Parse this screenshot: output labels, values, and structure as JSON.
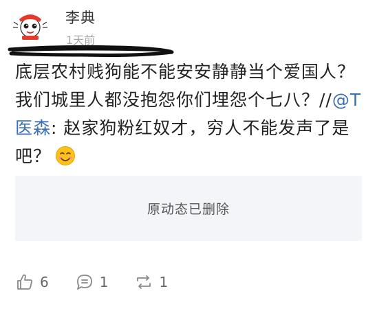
{
  "post": {
    "author": "李典",
    "time": "1天前",
    "text_main": "底层农村贱狗能不能安安静静当个爱国人？我们城里人都没抱怨你们埋怨个七八？//",
    "mention": "@T医森",
    "text_tail": ": 赵家狗粉红奴才，穷人不能发声了是吧？",
    "emoji": "smiling-face-emoji",
    "deleted_notice": "原动态已删除"
  },
  "actions": {
    "likes": "6",
    "comments": "1",
    "reposts": "1"
  },
  "colors": {
    "mention": "#3a6fb4",
    "deleted_bg": "#f4f5f9",
    "muted": "#aaaaaa"
  }
}
